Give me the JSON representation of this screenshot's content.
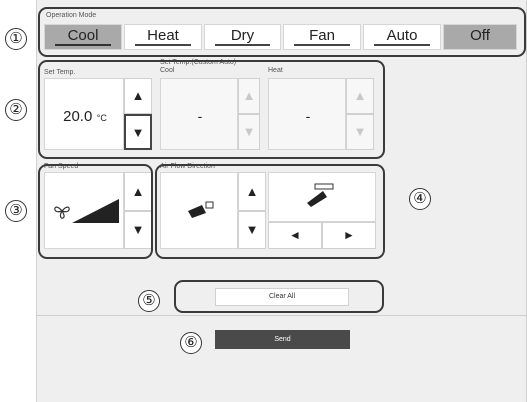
{
  "operation_mode": {
    "label": "Operation Mode",
    "options": [
      "Cool",
      "Heat",
      "Dry",
      "Fan",
      "Auto",
      "Off"
    ],
    "selected": "Cool"
  },
  "set_temp": {
    "label": "Set Temp.",
    "value": "20.0",
    "unit": "°C"
  },
  "custom_auto": {
    "label": "Set Temp.(Custom Auto)",
    "cool_label": "Cool",
    "cool_value": "-",
    "heat_label": "Heat",
    "heat_value": "-"
  },
  "fan_speed": {
    "label": "Fan Speed"
  },
  "air_flow": {
    "label": "Air Flow Direction"
  },
  "actions": {
    "clear_all": "Clear All",
    "send": "Send"
  },
  "callouts": [
    "①",
    "②",
    "③",
    "④",
    "⑤",
    "⑥"
  ],
  "colors": {
    "selected_mode": "#a9a9a9",
    "send_button": "#4a4a4a"
  }
}
